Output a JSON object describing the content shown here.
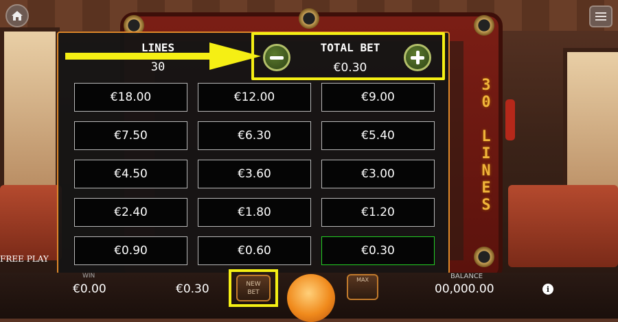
{
  "background": {
    "side_text": "30 LINES"
  },
  "panel": {
    "lines_label": "LINES",
    "lines_value": "30",
    "total_bet_label": "TOTAL BET",
    "total_bet_value": "€0.30",
    "bet_options": [
      "€18.00",
      "€12.00",
      "€9.00",
      "€7.50",
      "€6.30",
      "€5.40",
      "€4.50",
      "€3.60",
      "€3.00",
      "€2.40",
      "€1.80",
      "€1.20",
      "€0.90",
      "€0.60",
      "€0.30"
    ],
    "selected_bet": "€0.30",
    "highlight_color": "#f5ef14",
    "selected_color": "#25d025",
    "border_color": "#e0892a"
  },
  "bottom": {
    "free_play": "FREE PLAY",
    "win_label": "WIN",
    "win_value": "€0.00",
    "bet_value": "€0.30",
    "new_bet_line1": "NEW",
    "new_bet_line2": "BET",
    "max_label": "MAX",
    "balance_label": "BALANCE",
    "balance_value": "00,000.00",
    "info_icon": "i"
  },
  "icons": {
    "home": "home-icon",
    "menu": "hamburger-menu-icon",
    "minus": "minus-icon",
    "plus": "plus-icon",
    "info": "info-icon",
    "arrow": "arrow-right-icon"
  }
}
